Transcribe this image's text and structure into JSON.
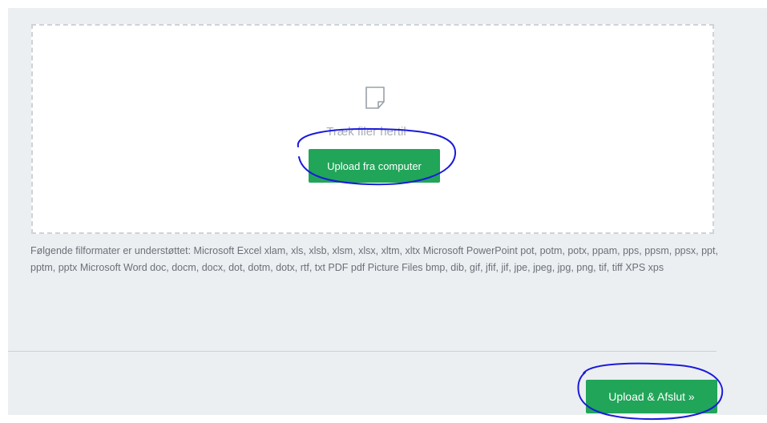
{
  "dropzone": {
    "icon": "file-icon",
    "drop_text": "Træk filer hertil",
    "upload_button_label": "Upload fra computer"
  },
  "supported_formats_text": "Følgende filformater er understøttet: Microsoft Excel xlam, xls, xlsb, xlsm, xlsx, xltm, xltx Microsoft PowerPoint pot, potm, potx, ppam, pps, ppsm, ppsx, ppt, pptm, pptx Microsoft Word doc, docm, docx, dot, dotm, dotx, rtf, txt PDF pdf Picture Files bmp, dib, gif, jfif, jif, jpe, jpeg, jpg, png, tif, tiff XPS xps",
  "footer": {
    "finish_button_label": "Upload & Afslut »"
  },
  "colors": {
    "accent": "#21a559",
    "panel_bg": "#eceff2",
    "annotation_ink": "#1a1adb"
  }
}
